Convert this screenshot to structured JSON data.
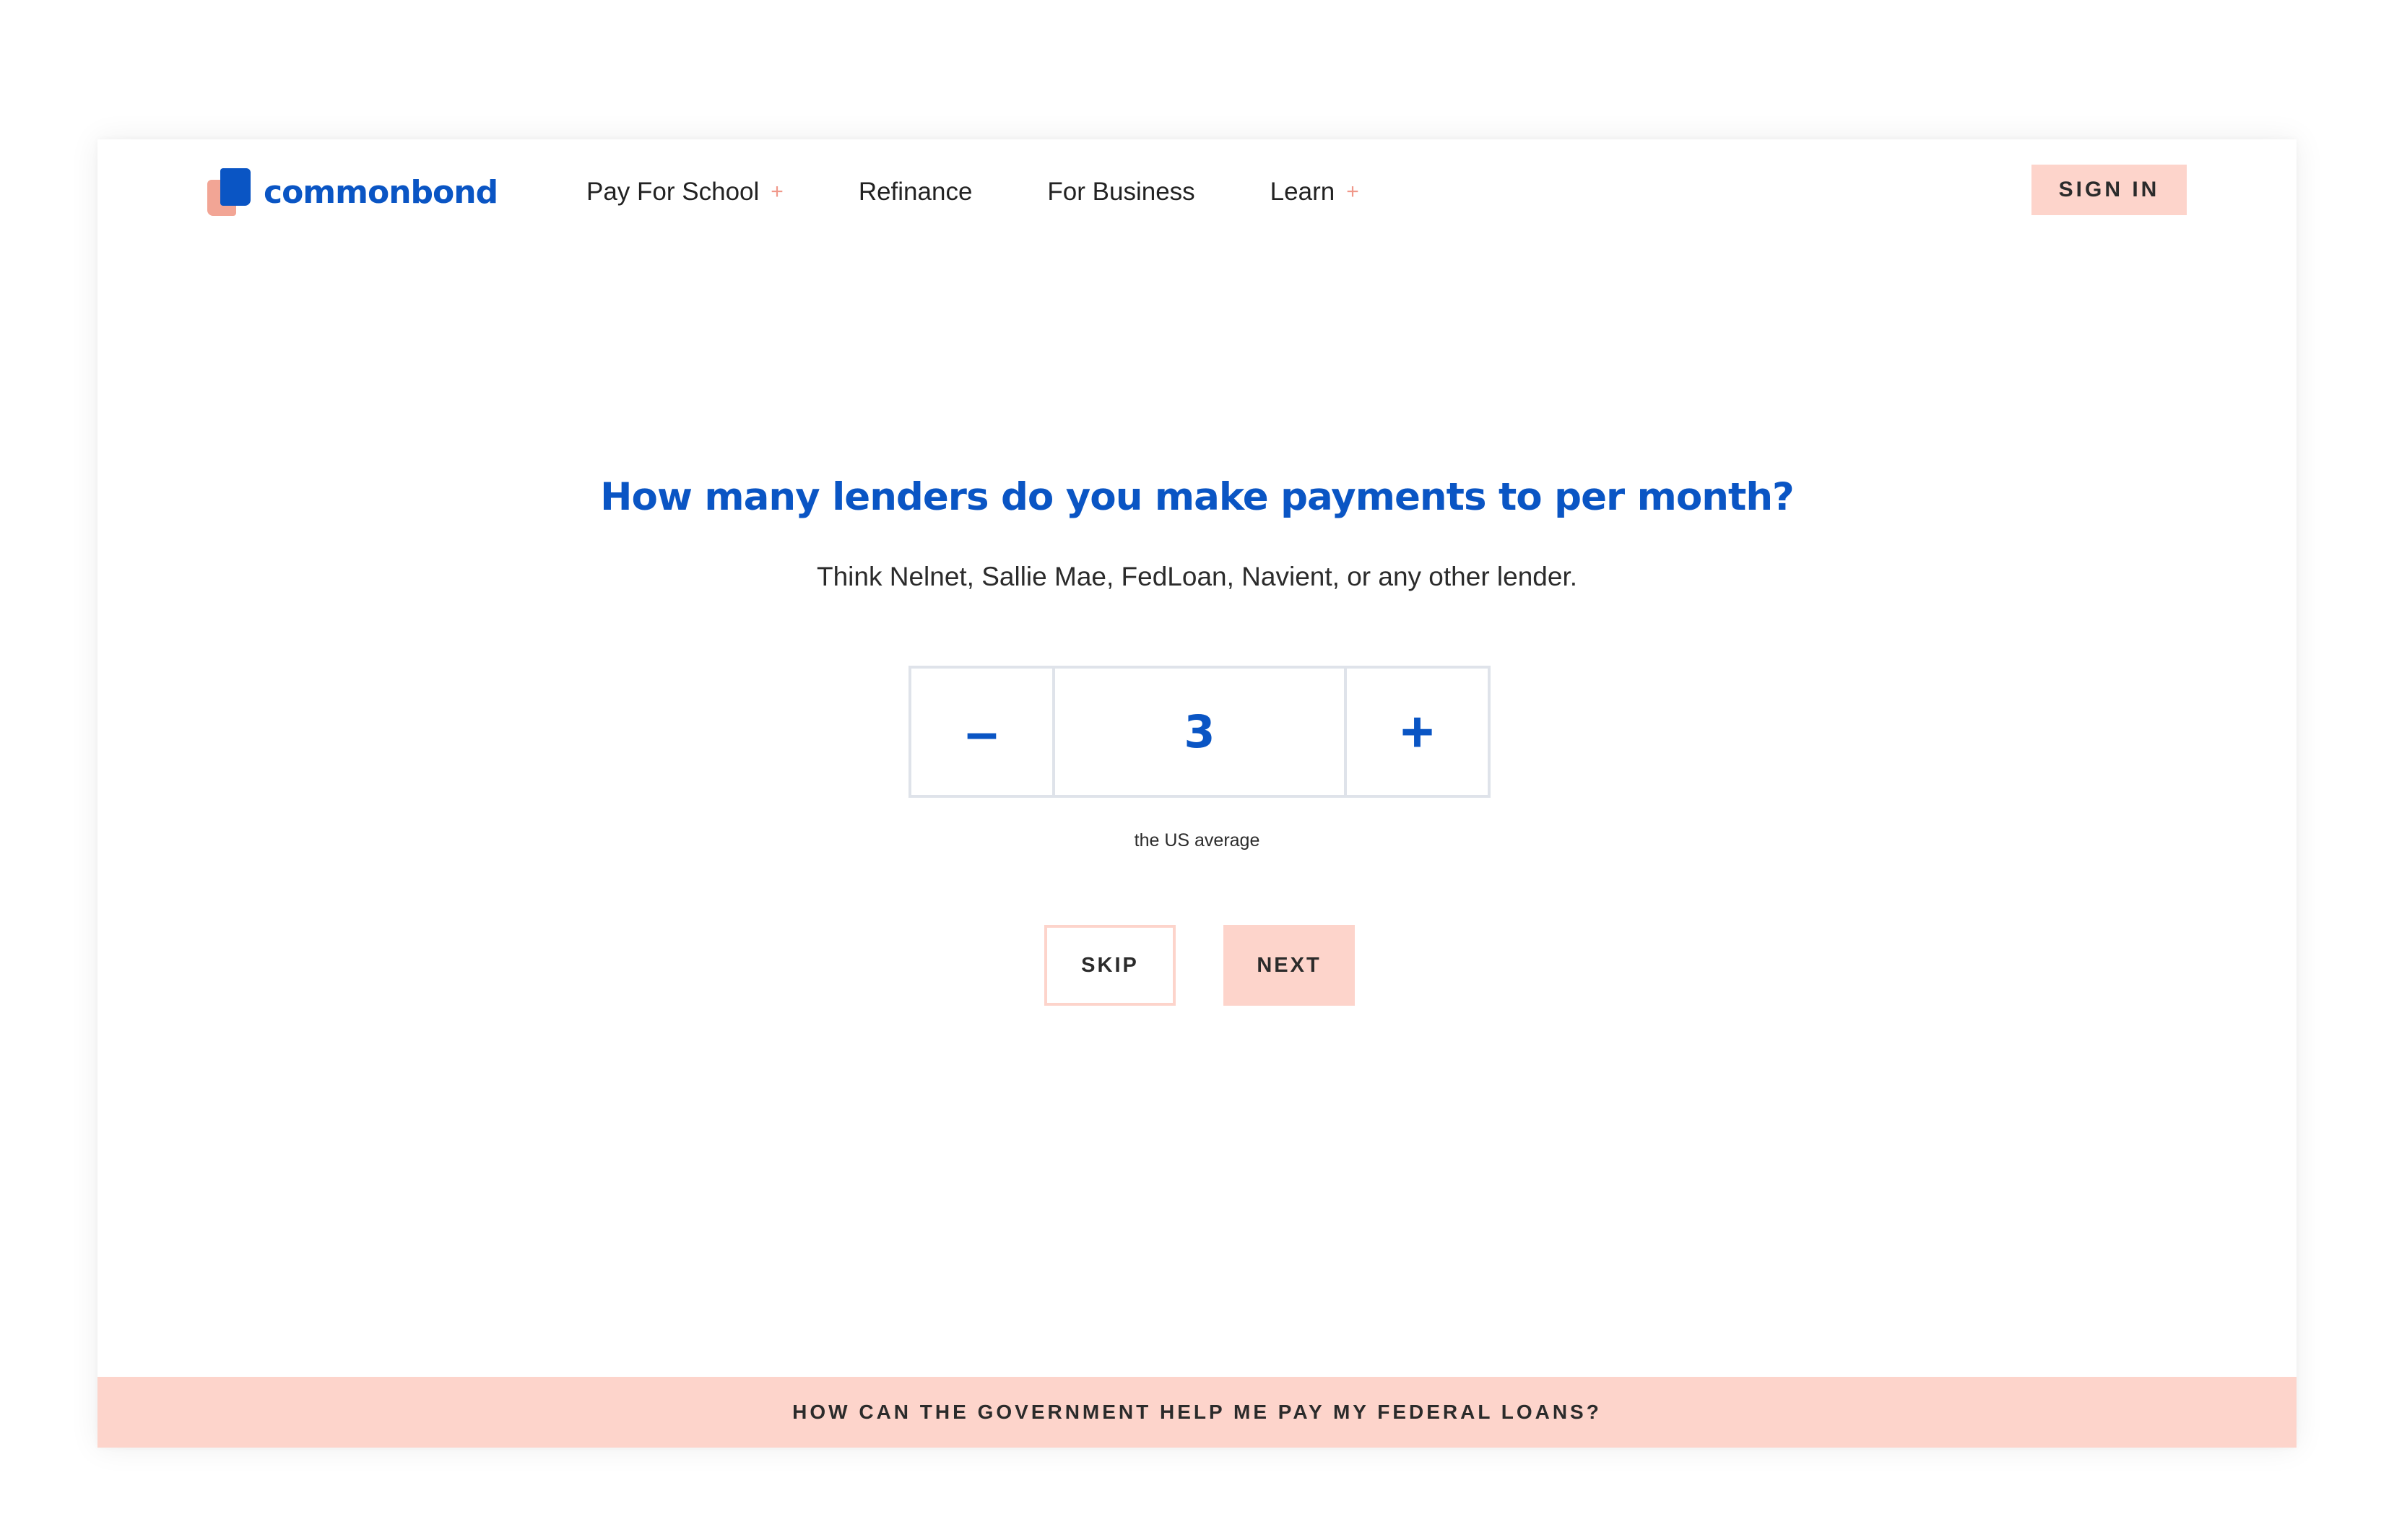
{
  "brand": {
    "name": "commonbond",
    "colors": {
      "primary": "#0a55c4",
      "accent": "#f2a595",
      "peach": "#fdd4cb",
      "border": "#dfe3ea"
    }
  },
  "nav": {
    "items": [
      {
        "label": "Pay For School",
        "has_submenu": true,
        "submenu_icon": "+"
      },
      {
        "label": "Refinance",
        "has_submenu": false
      },
      {
        "label": "For Business",
        "has_submenu": false
      },
      {
        "label": "Learn",
        "has_submenu": true,
        "submenu_icon": "+"
      }
    ],
    "sign_in_label": "SIGN IN"
  },
  "question": {
    "title": "How many lenders do you make payments to per month?",
    "subtitle": "Think Nelnet, Sallie Mae, FedLoan, Navient, or any other lender."
  },
  "stepper": {
    "decrement_icon": "–",
    "increment_icon": "+",
    "value": "3",
    "hint": "the US average"
  },
  "actions": {
    "skip_label": "SKIP",
    "next_label": "NEXT"
  },
  "footer": {
    "banner_label": "HOW CAN THE GOVERNMENT HELP ME PAY MY FEDERAL LOANS?"
  }
}
